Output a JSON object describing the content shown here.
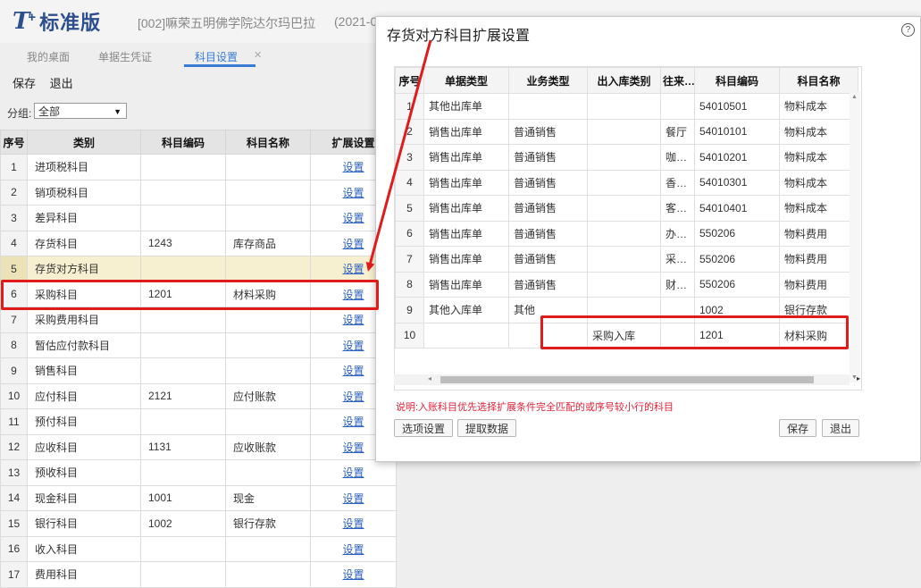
{
  "header": {
    "logo_letter": "T",
    "logo_plus": "+",
    "product_name": "标准版",
    "org_name": "[002]嘛荣五明佛学院达尔玛巴拉",
    "date_fragment": "(2021-0"
  },
  "tabs": [
    {
      "label": "我的桌面"
    },
    {
      "label": "单据生凭证"
    },
    {
      "label": "科目设置"
    }
  ],
  "toolbar": {
    "save": "保存",
    "exit": "退出"
  },
  "group": {
    "label": "分组:",
    "value": "全部"
  },
  "main_table": {
    "columns": [
      "序号",
      "类别",
      "科目编码",
      "科目名称",
      "扩展设置"
    ],
    "link_text": "设置",
    "rows": [
      {
        "no": "1",
        "category": "进项税科目",
        "code": "",
        "name": ""
      },
      {
        "no": "2",
        "category": "销项税科目",
        "code": "",
        "name": ""
      },
      {
        "no": "3",
        "category": "差异科目",
        "code": "",
        "name": ""
      },
      {
        "no": "4",
        "category": "存货科目",
        "code": "1243",
        "name": "库存商品"
      },
      {
        "no": "5",
        "category": "存货对方科目",
        "code": "",
        "name": ""
      },
      {
        "no": "6",
        "category": "采购科目",
        "code": "1201",
        "name": "材料采购"
      },
      {
        "no": "7",
        "category": "采购费用科目",
        "code": "",
        "name": ""
      },
      {
        "no": "8",
        "category": "暂估应付款科目",
        "code": "",
        "name": ""
      },
      {
        "no": "9",
        "category": "销售科目",
        "code": "",
        "name": ""
      },
      {
        "no": "10",
        "category": "应付科目",
        "code": "2121",
        "name": "应付账款"
      },
      {
        "no": "11",
        "category": "预付科目",
        "code": "",
        "name": ""
      },
      {
        "no": "12",
        "category": "应收科目",
        "code": "1131",
        "name": "应收账款"
      },
      {
        "no": "13",
        "category": "预收科目",
        "code": "",
        "name": ""
      },
      {
        "no": "14",
        "category": "现金科目",
        "code": "1001",
        "name": "现金"
      },
      {
        "no": "15",
        "category": "银行科目",
        "code": "1002",
        "name": "银行存款"
      },
      {
        "no": "16",
        "category": "收入科目",
        "code": "",
        "name": ""
      },
      {
        "no": "17",
        "category": "费用科目",
        "code": "",
        "name": ""
      }
    ]
  },
  "dialog": {
    "title": "存货对方科目扩展设置",
    "help": "?",
    "columns": [
      "序号",
      "单据类型",
      "业务类型",
      "出入库类别",
      "往来…",
      "科目编码",
      "科目名称"
    ],
    "rows": [
      {
        "no": "1",
        "doc": "其他出库单",
        "biz": "",
        "io": "",
        "party": "",
        "code": "54010501",
        "name": "物料成本"
      },
      {
        "no": "2",
        "doc": "销售出库单",
        "biz": "普通销售",
        "io": "",
        "party": "餐厅",
        "code": "54010101",
        "name": "物料成本"
      },
      {
        "no": "3",
        "doc": "销售出库单",
        "biz": "普通销售",
        "io": "",
        "party": "咖…",
        "code": "54010201",
        "name": "物料成本"
      },
      {
        "no": "4",
        "doc": "销售出库单",
        "biz": "普通销售",
        "io": "",
        "party": "香…",
        "code": "54010301",
        "name": "物料成本"
      },
      {
        "no": "5",
        "doc": "销售出库单",
        "biz": "普通销售",
        "io": "",
        "party": "客…",
        "code": "54010401",
        "name": "物料成本"
      },
      {
        "no": "6",
        "doc": "销售出库单",
        "biz": "普通销售",
        "io": "",
        "party": "办…",
        "code": "550206",
        "name": "物料费用"
      },
      {
        "no": "7",
        "doc": "销售出库单",
        "biz": "普通销售",
        "io": "",
        "party": "采…",
        "code": "550206",
        "name": "物料费用"
      },
      {
        "no": "8",
        "doc": "销售出库单",
        "biz": "普通销售",
        "io": "",
        "party": "财…",
        "code": "550206",
        "name": "物料费用"
      },
      {
        "no": "9",
        "doc": "其他入库单",
        "biz": "其他",
        "io": "",
        "party": "",
        "code": "1002",
        "name": "银行存款"
      },
      {
        "no": "10",
        "doc": "",
        "biz": "",
        "io": "采购入库",
        "party": "",
        "code": "1201",
        "name": "材料采购"
      }
    ],
    "note": "说明:入账科目优先选择扩展条件完全匹配的或序号较小行的科目",
    "btn_options": "选项设置",
    "btn_fetch": "提取数据",
    "btn_save": "保存",
    "btn_exit": "退出"
  },
  "colors": {
    "highlight": "#e01b1b",
    "link": "#2b5fbf",
    "accent": "#3a7bd5",
    "note": "#e0243a"
  }
}
